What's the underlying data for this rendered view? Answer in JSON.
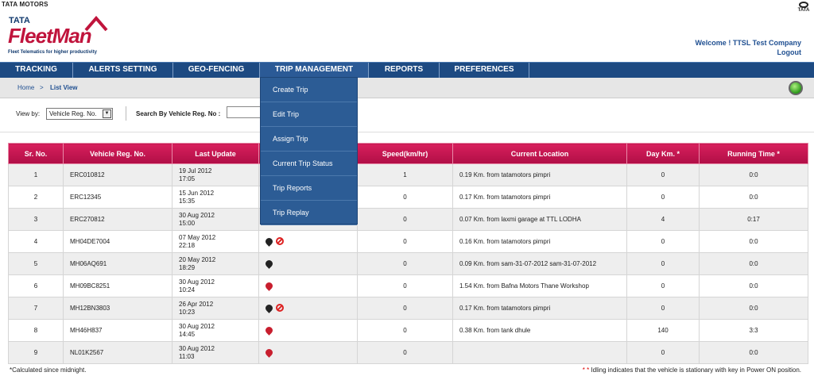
{
  "header": {
    "brand_top": "TATA MOTORS",
    "brand_top_right": "TATA",
    "logo_tata": "TATA",
    "logo_name": "FleetMan",
    "tagline": "Fleet Telematics for higher productivity",
    "welcome": "Welcome ! TTSL Test Company",
    "logout": "Logout"
  },
  "nav": {
    "items": [
      "TRACKING",
      "ALERTS SETTING",
      "GEO-FENCING",
      "TRIP MANAGEMENT",
      "REPORTS",
      "PREFERENCES"
    ],
    "active": "TRIP MANAGEMENT"
  },
  "dropdown": {
    "items": [
      "Create Trip",
      "Edit Trip",
      "Assign Trip",
      "Current Trip Status",
      "Trip Reports",
      "Trip Replay"
    ]
  },
  "breadcrumb": {
    "home": "Home",
    "sep": ">",
    "current": "List View"
  },
  "filters": {
    "view_by_label": "View by:",
    "view_by_value": "Vehicle Reg. No.",
    "search_label": "Search By Vehicle Reg. No :"
  },
  "table": {
    "headers": [
      "Sr. No.",
      "Vehicle Reg. No.",
      "Last Update",
      "",
      "Speed(km/hr)",
      "Current Location",
      "Day Km. *",
      "Running Time *"
    ],
    "rows": [
      {
        "sr": "1",
        "reg": "ERC010812",
        "date": "19 Jul 2012",
        "time": "17:05",
        "icons": "",
        "speed": "1",
        "loc": "0.19 Km. from tatamotors pimpri",
        "km": "0",
        "run": "0:0"
      },
      {
        "sr": "2",
        "reg": "ERC12345",
        "date": "15 Jun 2012",
        "time": "15:35",
        "icons": "",
        "speed": "0",
        "loc": "0.17 Km. from tatamotors pimpri",
        "km": "0",
        "run": "0:0"
      },
      {
        "sr": "3",
        "reg": "ERC270812",
        "date": "30 Aug 2012",
        "time": "15:00",
        "icons": "",
        "speed": "0",
        "loc": "0.07 Km. from laxmi garage at TTL LODHA",
        "km": "4",
        "run": "0:17"
      },
      {
        "sr": "4",
        "reg": "MH04DE7004",
        "date": "07 May 2012",
        "time": "22:18",
        "icons": "black-noent",
        "speed": "0",
        "loc": "0.16 Km. from tatamotors pimpri",
        "km": "0",
        "run": "0:0"
      },
      {
        "sr": "5",
        "reg": "MH06AQ691",
        "date": "20 May 2012",
        "time": "18:29",
        "icons": "black",
        "speed": "0",
        "loc": "0.09 Km. from sam-31-07-2012 sam-31-07-2012",
        "km": "0",
        "run": "0:0"
      },
      {
        "sr": "6",
        "reg": "MH09BC8251",
        "date": "30 Aug 2012",
        "time": "10:24",
        "icons": "red",
        "speed": "0",
        "loc": "1.54 Km. from Bafna Motors Thane Workshop",
        "km": "0",
        "run": "0:0"
      },
      {
        "sr": "7",
        "reg": "MH12BN3803",
        "date": "26 Apr 2012",
        "time": "10:23",
        "icons": "black-noent",
        "speed": "0",
        "loc": "0.17 Km. from tatamotors pimpri",
        "km": "0",
        "run": "0:0"
      },
      {
        "sr": "8",
        "reg": "MH46H837",
        "date": "30 Aug 2012",
        "time": "14:45",
        "icons": "red",
        "speed": "0",
        "loc": "0.38 Km. from tank dhule",
        "km": "140",
        "run": "3:3"
      },
      {
        "sr": "9",
        "reg": "NL01K2567",
        "date": "30 Aug 2012",
        "time": "11:03",
        "icons": "red",
        "speed": "0",
        "loc": "",
        "km": "0",
        "run": "0:0"
      }
    ]
  },
  "footer": {
    "left": "*Calculated since midnight.",
    "right_star": "* *",
    "right": " Idling indicates that the vehicle is stationary with key in Power ON position."
  },
  "colors": {
    "nav": "#1d4a82",
    "dropdown": "#2c5c95",
    "header_row": "#c4144f",
    "brand_red": "#c0143c"
  }
}
